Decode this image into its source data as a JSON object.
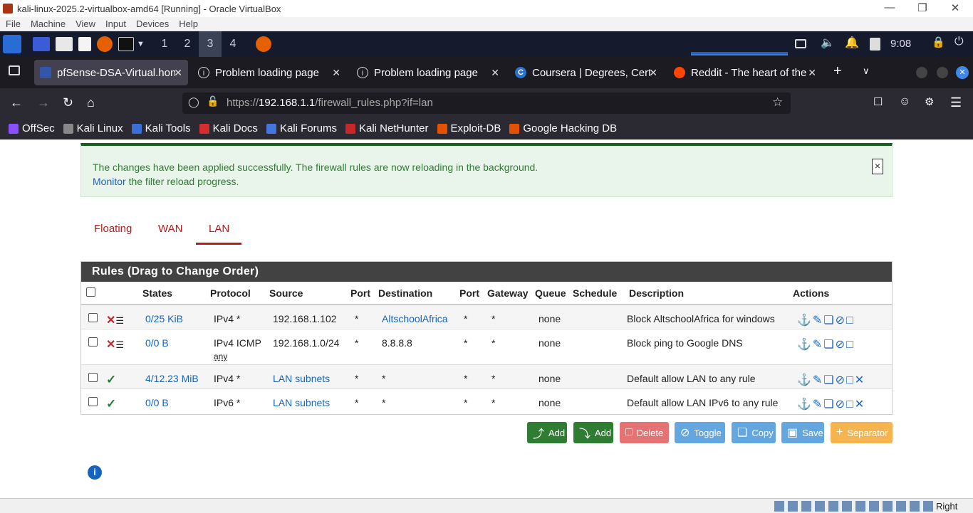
{
  "vbox": {
    "title": "kali-linux-2025.2-virtualbox-amd64 [Running] - Oracle VirtualBox",
    "menu": [
      "File",
      "Machine",
      "View",
      "Input",
      "Devices",
      "Help"
    ],
    "host_key": "Right Ctrl"
  },
  "kali_panel": {
    "workspaces": [
      "1",
      "2",
      "3",
      "4"
    ],
    "active_workspace": "3",
    "clock": "9:08"
  },
  "browser": {
    "tabs": [
      {
        "label": "pfSense-DSA-Virtual.hon",
        "active": true
      },
      {
        "label": "Problem loading page",
        "active": false
      },
      {
        "label": "Problem loading page",
        "active": false
      },
      {
        "label": "Coursera | Degrees, Certi",
        "active": false
      },
      {
        "label": "Reddit - The heart of the i",
        "active": false
      }
    ],
    "url_prefix": "https://",
    "url_host": "192.168.1.1",
    "url_path": "/firewall_rules.php?if=lan",
    "bookmarks": [
      "OffSec",
      "Kali Linux",
      "Kali Tools",
      "Kali Docs",
      "Kali Forums",
      "Kali NetHunter",
      "Exploit-DB",
      "Google Hacking DB"
    ]
  },
  "alert": {
    "line1": "The changes have been applied successfully. The firewall rules are now reloading in the background.",
    "link": "Monitor",
    "line2_rest": " the filter reload progress.",
    "close": "×"
  },
  "filter_tabs": [
    "Floating",
    "WAN",
    "LAN"
  ],
  "active_filter_tab": "LAN",
  "rules": {
    "heading": "Rules (Drag to Change Order)",
    "columns": [
      "States",
      "Protocol",
      "Source",
      "Port",
      "Destination",
      "Port",
      "Gateway",
      "Queue",
      "Schedule",
      "Description",
      "Actions"
    ],
    "rows": [
      {
        "states": "0/25 KiB",
        "protocol": "IPv4 *",
        "protocol_sub": "",
        "source": "192.168.1.102",
        "port": "*",
        "destination": "AltschoolAfrica",
        "dport": "*",
        "gateway": "*",
        "queue": "none",
        "schedule": "",
        "description": "Block AltschoolAfrica for windows"
      },
      {
        "states": "0/0 B",
        "protocol": "IPv4 ICMP",
        "protocol_sub": "any",
        "source": "192.168.1.0/24",
        "port": "*",
        "destination": "8.8.8.8",
        "dport": "*",
        "gateway": "*",
        "queue": "none",
        "schedule": "",
        "description": "Block ping to Google DNS"
      },
      {
        "states": "4/12.23 MiB",
        "protocol": "IPv4 *",
        "protocol_sub": "",
        "source": "LAN subnets",
        "port": "*",
        "destination": "*",
        "dport": "*",
        "gateway": "*",
        "queue": "none",
        "schedule": "",
        "description": "Default allow LAN to any rule"
      },
      {
        "states": "0/0 B",
        "protocol": "IPv6 *",
        "protocol_sub": "",
        "source": "LAN subnets",
        "port": "*",
        "destination": "*",
        "dport": "*",
        "gateway": "*",
        "queue": "none",
        "schedule": "",
        "description": "Default allow LAN IPv6 to any rule"
      }
    ]
  },
  "buttons": {
    "add_top": "Add",
    "add_bottom": "Add",
    "delete": "Delete",
    "toggle": "Toggle",
    "copy": "Copy",
    "save": "Save",
    "separator": "Separator"
  },
  "colors": {
    "tab_accent": "#b71c1c",
    "success": "#2e7d32",
    "panel_header": "#424242",
    "btn_add": "#2e7d32",
    "btn_delete": "#e57373",
    "btn_blue": "#64a6e0",
    "btn_separator": "#f5b450"
  }
}
